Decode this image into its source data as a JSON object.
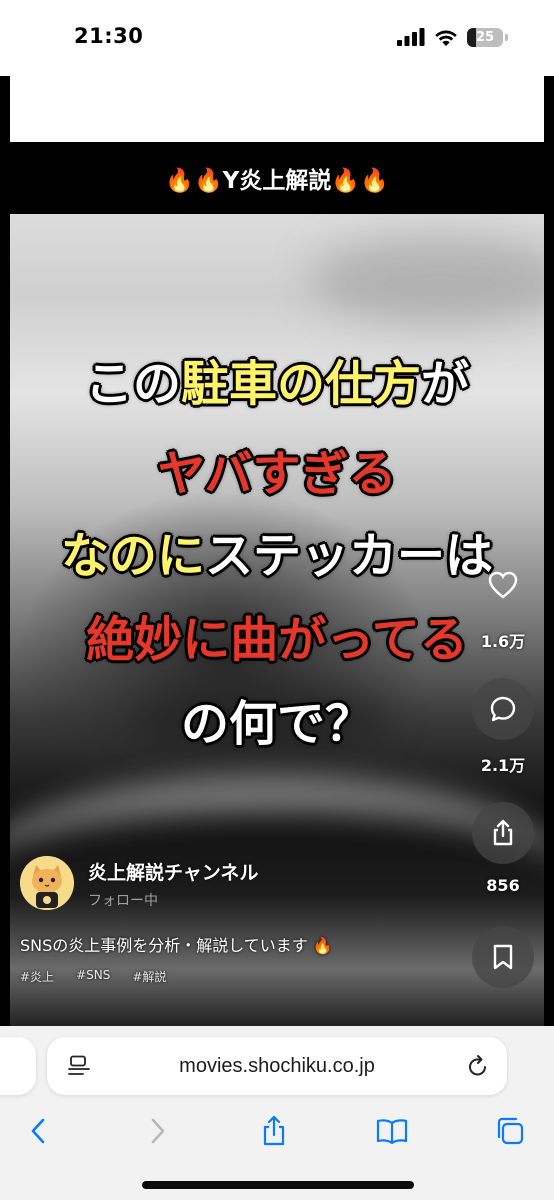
{
  "status_bar": {
    "time": "21:30",
    "battery": "25",
    "icons": [
      "signal-icon",
      "wifi-icon",
      "battery-icon"
    ]
  },
  "account": {
    "title": "🔥🔥Y炎上解説🔥🔥"
  },
  "caption": {
    "line1_a": "この",
    "line1_b": "駐車の仕方",
    "line1_c": "が",
    "line2": "ヤバすぎる",
    "line3_a": "なのに",
    "line3_b": "ステッカーは",
    "line4": "絶妙に曲がってる",
    "line5": "の何で？"
  },
  "actions": {
    "likes": "1.6万",
    "comments": "2.1万",
    "shares": "856"
  },
  "creator": {
    "channel_name": "炎上解説チャンネル",
    "follow_text": "フォロー中",
    "description": "SNSの炎上事例を分析・解説しています 🔥",
    "hashtags": [
      "#炎上",
      "#SNS",
      "#解説"
    ]
  },
  "browser": {
    "url": "movies.shochiku.co.jp"
  },
  "colors": {
    "accent_yellow": "#fff36b",
    "accent_red": "#e5382a",
    "chrome_bg": "#f2f2f2",
    "ios_blue": "#0a7aff"
  }
}
